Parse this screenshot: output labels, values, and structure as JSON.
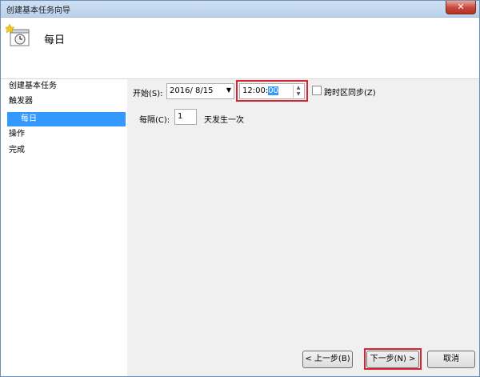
{
  "window": {
    "title": "创建基本任务向导",
    "close_glyph": "✕"
  },
  "header": {
    "title": "每日",
    "icon": "task-clock-icon"
  },
  "sidebar": {
    "items": [
      {
        "label": "创建基本任务",
        "selected": false
      },
      {
        "label": "触发器",
        "selected": false
      },
      {
        "label": "每日",
        "selected": true
      },
      {
        "label": "操作",
        "selected": false
      },
      {
        "label": "完成",
        "selected": false
      }
    ]
  },
  "schedule": {
    "start_label": "开始(S):",
    "date_value": "2016/  8/15",
    "date_arrow": "▼",
    "time_value_main": "12:00:",
    "time_value_selected": "00",
    "sync_timezones_label": "跨时区同步(Z)",
    "sync_timezones_checked": false,
    "interval_label": "每隔(C):",
    "interval_value": "1",
    "interval_unit": "天发生一次"
  },
  "buttons": {
    "back": "< 上一步(B)",
    "next": "下一步(N) >",
    "cancel": "取消"
  },
  "colors": {
    "highlight_red": "#d9232e",
    "selection_blue": "#3399ff"
  }
}
